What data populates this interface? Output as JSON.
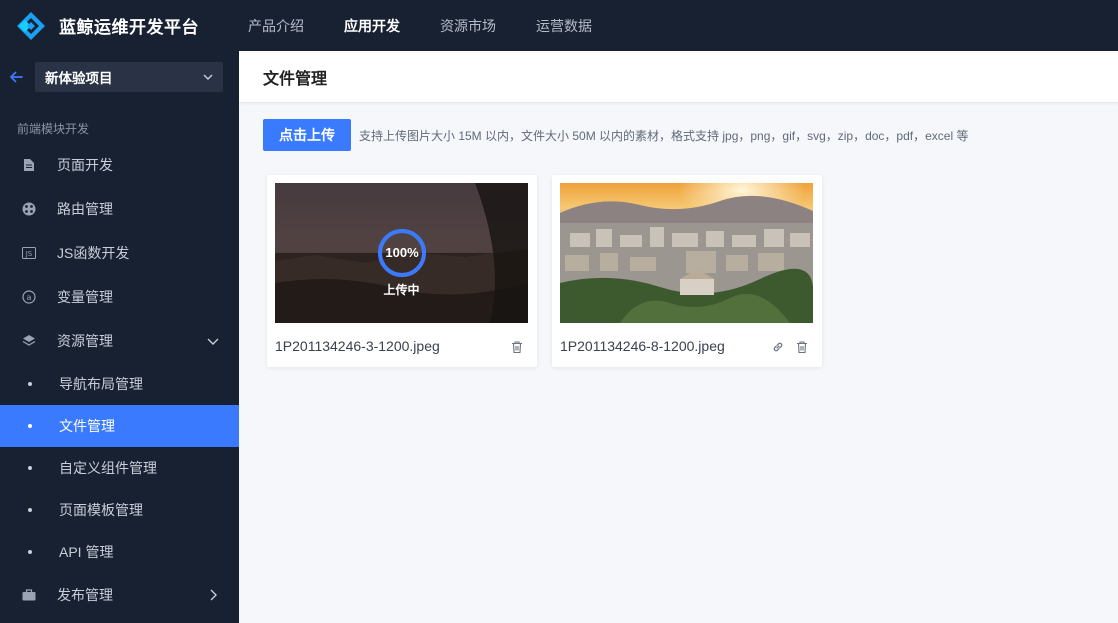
{
  "app": {
    "title": "蓝鲸运维开发平台"
  },
  "topnav": [
    {
      "label": "产品介绍",
      "active": false
    },
    {
      "label": "应用开发",
      "active": true
    },
    {
      "label": "资源市场",
      "active": false
    },
    {
      "label": "运营数据",
      "active": false
    }
  ],
  "sidebar": {
    "project": "新体验项目",
    "section_title": "前端模块开发",
    "items": [
      {
        "label": "页面开发",
        "icon": "page-icon"
      },
      {
        "label": "路由管理",
        "icon": "route-icon"
      },
      {
        "label": "JS函数开发",
        "icon": "js-icon"
      },
      {
        "label": "变量管理",
        "icon": "variable-icon"
      },
      {
        "label": "资源管理",
        "icon": "layers-icon"
      }
    ],
    "sub_items": [
      {
        "label": "导航布局管理"
      },
      {
        "label": "文件管理",
        "active": true
      },
      {
        "label": "自定义组件管理"
      },
      {
        "label": "页面模板管理"
      },
      {
        "label": "API 管理"
      }
    ],
    "publish": {
      "label": "发布管理",
      "icon": "briefcase-icon"
    }
  },
  "page": {
    "title": "文件管理"
  },
  "upload": {
    "button_label": "点击上传",
    "hint": "支持上传图片大小 15M 以内，文件大小 50M 以内的素材，格式支持 jpg，png，gif，svg，zip，doc，pdf，excel 等"
  },
  "files": [
    {
      "name": "1P201134246-3-1200.jpeg",
      "progress": 100,
      "progress_text": "100%",
      "status": "上传中",
      "uploading": true
    },
    {
      "name": "1P201134246-8-1200.jpeg",
      "uploading": false
    }
  ],
  "colors": {
    "accent": "#3a7afe",
    "sidebar_bg": "#182132",
    "topbar_bg": "#182132"
  }
}
